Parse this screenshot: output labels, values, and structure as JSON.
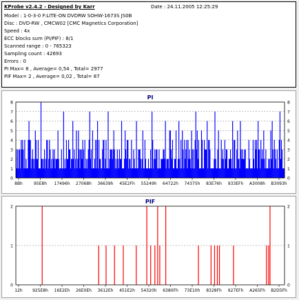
{
  "header": {
    "app_title": "KProbe v2.4.2 - Designed by Karr",
    "date_text": "Date : 24.11.2005 12:25:29",
    "lines": [
      "Model : 1-0-3-0 F:LITE-ON DVDRW SOHW-1673S JS0B",
      "Disc : DVD-RW , CMCW02 [CMC Magnetics Corporation]",
      "Speed : 4x",
      "ECC blocks sum (PI/PIF) : 8/1",
      "Scanned range : 0 - 765323",
      "Sampling count : 42693",
      "Errors : 0",
      "PI Max= 8 , Average= 0,54 , Total= 2977",
      "PIF Max= 2 , Average= 0,02 , Total= 87"
    ]
  },
  "colors": {
    "pi_bar": "#0000ff",
    "pif_bar": "#ff0000",
    "title_blue": "#000080",
    "grid": "#808080"
  },
  "chart_data": [
    {
      "type": "bar",
      "title": "PI",
      "ylim": [
        0,
        8
      ],
      "y_ticks": [
        "0",
        "1",
        "2",
        "3",
        "4",
        "5",
        "6",
        "7",
        "8"
      ],
      "x_tick_labels": [
        "8Bh",
        "95E8h",
        "17496h",
        "27068h",
        "36639h",
        "45E2Fh",
        "55249h",
        "64722h",
        "74375h",
        "83E76h",
        "933EFh",
        "A3008h",
        "B3093h"
      ],
      "grid": true,
      "x_range": [
        0,
        765323
      ],
      "peaks": [
        {
          "x": 70000,
          "y": 8
        },
        {
          "x": 136000,
          "y": 7
        },
        {
          "x": 210000,
          "y": 7
        },
        {
          "x": 263000,
          "y": 7
        },
        {
          "x": 388000,
          "y": 7
        },
        {
          "x": 512000,
          "y": 7
        },
        {
          "x": 567000,
          "y": 7
        },
        {
          "x": 37000,
          "y": 6
        },
        {
          "x": 162000,
          "y": 6
        },
        {
          "x": 232000,
          "y": 6
        },
        {
          "x": 300000,
          "y": 6
        },
        {
          "x": 344000,
          "y": 6
        },
        {
          "x": 427000,
          "y": 6
        },
        {
          "x": 465000,
          "y": 6
        },
        {
          "x": 545000,
          "y": 6
        },
        {
          "x": 618000,
          "y": 6
        },
        {
          "x": 640000,
          "y": 6
        },
        {
          "x": 690000,
          "y": 6
        },
        {
          "x": 732000,
          "y": 6
        },
        {
          "x": 753000,
          "y": 7
        }
      ]
    },
    {
      "type": "bar",
      "title": "PIF",
      "ylim": [
        0,
        2
      ],
      "y_ticks": [
        "0",
        "1",
        "2"
      ],
      "x_tick_labels": [
        "12h",
        "925E8h",
        "16E2Eh",
        "26E0Eh",
        "3612Eh",
        "451E2h",
        "54320h",
        "6380Fh",
        "73E10h",
        "8328Fh",
        "927EFh",
        "A265Fh",
        "B2D5Fh"
      ],
      "grid": true,
      "x_range": [
        0,
        765323
      ],
      "x": [
        75000,
        236000,
        257000,
        281000,
        306000,
        343000,
        373000,
        384000,
        396000,
        404000,
        410000,
        427000,
        520000,
        556000,
        566000,
        574000,
        580000,
        620000,
        714000,
        720000,
        724000
      ],
      "values": [
        2,
        1,
        1,
        1,
        1,
        1,
        2,
        1,
        1,
        2,
        1,
        2,
        1,
        1,
        1,
        1,
        1,
        1,
        1,
        1,
        2
      ]
    }
  ]
}
